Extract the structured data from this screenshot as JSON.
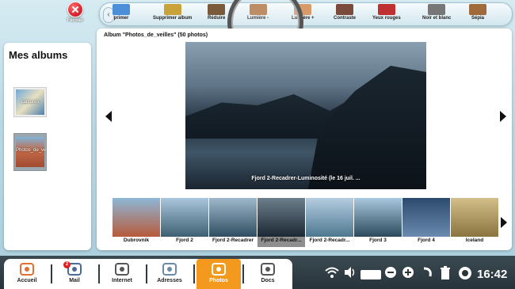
{
  "close": {
    "label": "Fermer"
  },
  "toolbar": {
    "tools": [
      {
        "label": "primer",
        "icon": "printer-icon",
        "color": "#4a8fd8"
      },
      {
        "label": "Supprimer album",
        "icon": "trash-album-icon",
        "color": "#c9a23a"
      },
      {
        "label": "Réduire",
        "icon": "reduce-icon",
        "color": "#7a5a3a"
      },
      {
        "label": "Lumière -",
        "icon": "light-minus-icon",
        "color": "#b27a4a"
      },
      {
        "label": "Lumière +",
        "icon": "light-plus-icon",
        "color": "#d99a6a"
      },
      {
        "label": "Contraste",
        "icon": "contrast-icon",
        "color": "#7a4a3a"
      },
      {
        "label": "Yeux rouges",
        "icon": "red-eye-icon",
        "color": "#c03030"
      },
      {
        "label": "Noir et blanc",
        "icon": "black-white-icon",
        "color": "#777777"
      },
      {
        "label": "Sépia",
        "icon": "sepia-icon",
        "color": "#a06a3a"
      }
    ]
  },
  "sidebar": {
    "title": "Mes albums",
    "albums": [
      {
        "label": "captures"
      },
      {
        "label": "Photos_de_ve..."
      }
    ]
  },
  "main": {
    "album_title": "Album \"Photos_de_veilles\" (50 photos)",
    "photo_caption": "Fjord 2-Recadrer-Luminosité (le 16 juil. ...",
    "thumbnails": [
      {
        "label": "Dubrovnik",
        "colors": [
          "#8db7d8",
          "#b85a3a"
        ]
      },
      {
        "label": "Fjord 2",
        "colors": [
          "#aac6dc",
          "#3e5f72"
        ]
      },
      {
        "label": "Fjord 2-Recadrer",
        "colors": [
          "#9fb8cc",
          "#2f4e61"
        ]
      },
      {
        "label": "Fjord 2-Recadr...",
        "colors": [
          "#6d7f8c",
          "#1c2834"
        ]
      },
      {
        "label": "Fjord 2-Recadr...",
        "colors": [
          "#b5cde0",
          "#4d7890"
        ]
      },
      {
        "label": "Fjord 3",
        "colors": [
          "#a9c7de",
          "#2c4a5c"
        ]
      },
      {
        "label": "Fjord 4",
        "colors": [
          "#2c4a6c",
          "#6a8ab0"
        ]
      },
      {
        "label": "Iceland",
        "colors": [
          "#d3bf8a",
          "#8a7440"
        ]
      }
    ],
    "selected_thumbnail": 3
  },
  "taskbar": {
    "apps": [
      {
        "label": "Accueil",
        "icon": "home-icon"
      },
      {
        "label": "Mail",
        "icon": "mail-icon"
      },
      {
        "label": "Internet",
        "icon": "globe-icon"
      },
      {
        "label": "Adresses",
        "icon": "contacts-icon"
      },
      {
        "label": "Photos",
        "icon": "camera-icon"
      },
      {
        "label": "Docs",
        "icon": "docs-icon"
      }
    ],
    "mail_badge": "2",
    "time": "16:42"
  }
}
